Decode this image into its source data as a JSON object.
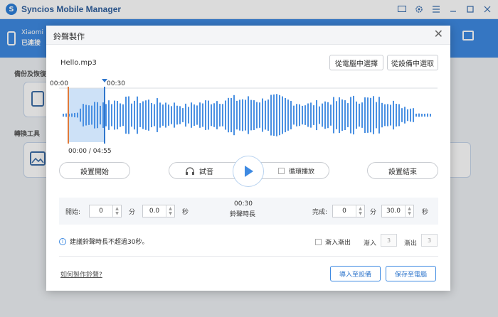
{
  "app": {
    "title": "Syncios Mobile Manager",
    "logo_letter": "S"
  },
  "device": {
    "name": "Xiaomi",
    "status": "已連接"
  },
  "sections": {
    "backup": "備份及恢復",
    "tools": "轉換工具"
  },
  "modal": {
    "title": "鈴聲製作",
    "file_name": "Hello.mp3",
    "from_pc": "從電腦中選擇",
    "from_device": "從設備中選取",
    "sel_start": "00:00",
    "sel_end": "00:30",
    "position": "00:00 / 04:55",
    "set_start": "設置開始",
    "preview": "試音",
    "loop": "循環播放",
    "set_end": "設置結束",
    "start_label": "開始:",
    "start_min": "0",
    "min_unit": "分",
    "start_sec": "0.0",
    "sec_unit": "秒",
    "duration_value": "00:30",
    "duration_label": "鈴聲時長",
    "end_label": "完成:",
    "end_min": "0",
    "end_sec": "30.0",
    "tip": "建議鈴聲時長不超過30秒。",
    "fade_in_out": "漸入漸出",
    "fade_in": "漸入",
    "fade_in_val": "3",
    "fade_out": "漸出",
    "fade_out_val": "3",
    "help": "如何製作鈴聲?",
    "import_device": "導入至設備",
    "save_pc": "保存至電腦"
  },
  "colors": {
    "accent": "#3e8ae2",
    "waveform": "#4a90e2",
    "selection": "#cde1f7",
    "start_marker": "#e07a3a"
  },
  "icons": [
    "settings-icon",
    "menu-icon",
    "minimize-icon",
    "maximize-icon",
    "close-icon",
    "headphones-icon",
    "play-icon",
    "info-icon"
  ]
}
